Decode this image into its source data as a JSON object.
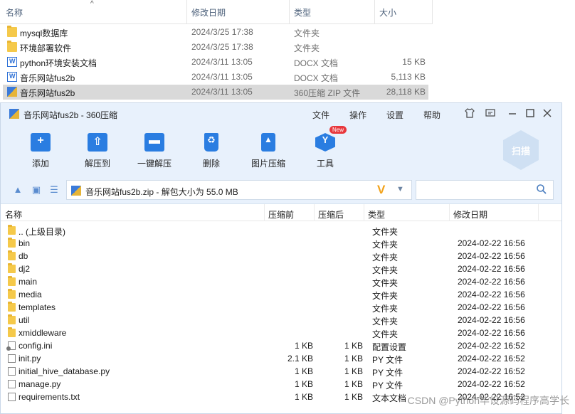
{
  "explorer": {
    "columns": [
      "名称",
      "修改日期",
      "类型",
      "大小"
    ],
    "sort_indicator": "^",
    "rows": [
      {
        "name": "mysql数据库",
        "date": "2024/3/25 17:38",
        "type": "文件夹",
        "size": "",
        "icon": "folder-icon"
      },
      {
        "name": "环境部署软件",
        "date": "2024/3/25 17:38",
        "type": "文件夹",
        "size": "",
        "icon": "folder-icon"
      },
      {
        "name": "python环境安装文档",
        "date": "2024/3/11 13:05",
        "type": "DOCX 文档",
        "size": "15 KB",
        "icon": "docx-icon"
      },
      {
        "name": "音乐网站fus2b",
        "date": "2024/3/11 13:05",
        "type": "DOCX 文档",
        "size": "5,113 KB",
        "icon": "docx-icon"
      },
      {
        "name": "音乐网站fus2b",
        "date": "2024/3/11 13:05",
        "type": "360压缩 ZIP 文件",
        "size": "28,118 KB",
        "icon": "zip-icon"
      }
    ]
  },
  "zip_window": {
    "title": "音乐网站fus2b - 360压缩",
    "menu": [
      "文件",
      "操作",
      "设置",
      "帮助"
    ],
    "toolbar": [
      {
        "label": "添加",
        "icon": "add-icon"
      },
      {
        "label": "解压到",
        "icon": "extract-to-icon"
      },
      {
        "label": "一键解压",
        "icon": "one-click-extract-icon"
      },
      {
        "label": "删除",
        "icon": "delete-icon"
      },
      {
        "label": "图片压缩",
        "icon": "image-compress-icon"
      },
      {
        "label": "工具",
        "icon": "tools-icon",
        "badge": "New"
      }
    ],
    "scan_label": "扫描",
    "address": "音乐网站fus2b.zip - 解包大小为 55.0 MB",
    "columns": [
      "名称",
      "压缩前",
      "压缩后",
      "类型",
      "修改日期"
    ],
    "rows": [
      {
        "name": ".. (上级目录)",
        "before": "",
        "after": "",
        "type": "文件夹",
        "date": "",
        "icon": "folder-icon"
      },
      {
        "name": "bin",
        "before": "",
        "after": "",
        "type": "文件夹",
        "date": "2024-02-22 16:56",
        "icon": "folder-icon"
      },
      {
        "name": "db",
        "before": "",
        "after": "",
        "type": "文件夹",
        "date": "2024-02-22 16:56",
        "icon": "folder-icon"
      },
      {
        "name": "dj2",
        "before": "",
        "after": "",
        "type": "文件夹",
        "date": "2024-02-22 16:56",
        "icon": "folder-icon"
      },
      {
        "name": "main",
        "before": "",
        "after": "",
        "type": "文件夹",
        "date": "2024-02-22 16:56",
        "icon": "folder-icon"
      },
      {
        "name": "media",
        "before": "",
        "after": "",
        "type": "文件夹",
        "date": "2024-02-22 16:56",
        "icon": "folder-icon"
      },
      {
        "name": "templates",
        "before": "",
        "after": "",
        "type": "文件夹",
        "date": "2024-02-22 16:56",
        "icon": "folder-icon"
      },
      {
        "name": "util",
        "before": "",
        "after": "",
        "type": "文件夹",
        "date": "2024-02-22 16:56",
        "icon": "folder-icon"
      },
      {
        "name": "xmiddleware",
        "before": "",
        "after": "",
        "type": "文件夹",
        "date": "2024-02-22 16:56",
        "icon": "folder-icon"
      },
      {
        "name": "config.ini",
        "before": "1 KB",
        "after": "1 KB",
        "type": "配置设置",
        "date": "2024-02-22 16:52",
        "icon": "config-file-icon"
      },
      {
        "name": "init.py",
        "before": "2.1 KB",
        "after": "1 KB",
        "type": "PY 文件",
        "date": "2024-02-22 16:52",
        "icon": "file-icon"
      },
      {
        "name": "initial_hive_database.py",
        "before": "1 KB",
        "after": "1 KB",
        "type": "PY 文件",
        "date": "2024-02-22 16:52",
        "icon": "file-icon"
      },
      {
        "name": "manage.py",
        "before": "1 KB",
        "after": "1 KB",
        "type": "PY 文件",
        "date": "2024-02-22 16:52",
        "icon": "file-icon"
      },
      {
        "name": "requirements.txt",
        "before": "1 KB",
        "after": "1 KB",
        "type": "文本文档",
        "date": "2024-02-22 16:52",
        "icon": "file-icon"
      }
    ]
  },
  "watermark": "CSDN @Python毕设源码程序高学长",
  "colors": {
    "accent": "#2a7de1",
    "titlebar": "#e8f1fc",
    "folder": "#f5c94a",
    "selected": "#d9d9d9"
  }
}
